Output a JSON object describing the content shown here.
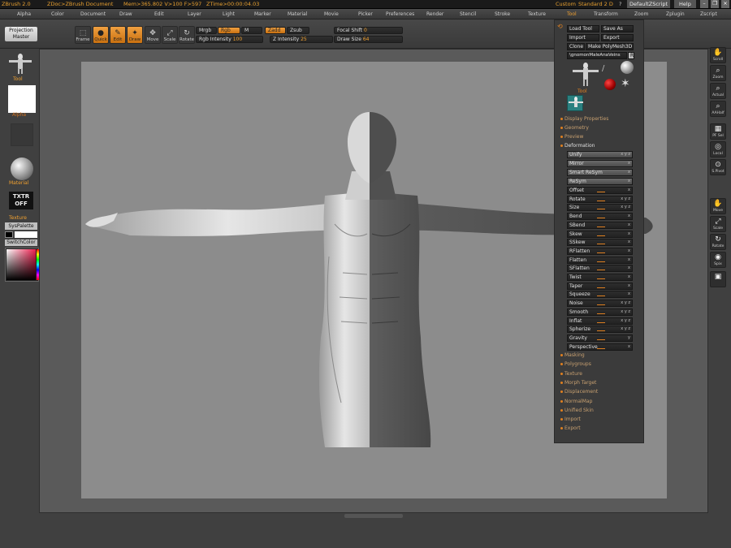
{
  "titlebar": {
    "app": "ZBrush 2.0",
    "document": "ZDoc>ZBrush Document",
    "stats": "Mem>365.802  V>100  F>597",
    "ztime": "ZTime>00:00:04.03",
    "custom": "Custom",
    "layout": "Standard 2 D",
    "question": "?",
    "script": "DefaultZScript",
    "help": "Help"
  },
  "menu": [
    "Alpha",
    "Color",
    "Document",
    "Draw",
    "Edit",
    "Layer",
    "Light",
    "Marker",
    "Material",
    "Movie",
    "Picker",
    "Preferences",
    "Render",
    "Stencil",
    "Stroke",
    "Texture",
    "Tool",
    "Transform",
    "Zoom",
    "Zplugin",
    "Zscript"
  ],
  "left": {
    "projection_master": "Projection Master",
    "tool_label": "Tool",
    "alpha_label": "Alpha",
    "material_label": "Material",
    "texture_button": "TXTR OFF",
    "texture_label": "Texture",
    "syspalette": "SysPalette",
    "switchcolor": "SwitchColor"
  },
  "toolbar": {
    "frame": "Frame",
    "quick": "Quick",
    "edit": "Edit",
    "draw": "Draw",
    "move": "Move",
    "scale": "Scale",
    "rotate": "Rotate",
    "mrgb": "Mrgb",
    "rgb": "Rgb",
    "m": "M",
    "zadd": "Zadd",
    "zsub": "Zsub",
    "rgb_intensity_label": "Rgb Intensity",
    "rgb_intensity_value": "100",
    "z_intensity_label": "Z Intensity",
    "z_intensity_value": "25",
    "focal_shift_label": "Focal Shift",
    "focal_shift_value": "0",
    "draw_size_label": "Draw Size",
    "draw_size_value": "64"
  },
  "toolpanel": {
    "load_tool": "Load Tool",
    "save_as": "Save As",
    "import": "Import",
    "export": "Export",
    "clone": "Clone",
    "make_polymesh": "Make PolyMesh3D",
    "current_tool": "\\gnomonMaleAnaVeins",
    "r_button": "R",
    "tool_label": "Tool",
    "sections_top": [
      "Display Properties",
      "Geometry",
      "Preview",
      "Deformation"
    ],
    "deform_top": [
      {
        "label": "Unify",
        "axes": "x y z"
      },
      {
        "label": "Mirror",
        "axes": "x"
      },
      {
        "label": "Smart ReSym",
        "axes": "x"
      },
      {
        "label": "ReSym",
        "axes": "x"
      }
    ],
    "deform_sliders": [
      {
        "label": "Offset",
        "axes": "x"
      },
      {
        "label": "Rotate",
        "axes": "x y z"
      },
      {
        "label": "Size",
        "axes": "x y z"
      },
      {
        "label": "Bend",
        "axes": "x"
      },
      {
        "label": "SBend",
        "axes": "x"
      },
      {
        "label": "Skew",
        "axes": "x"
      },
      {
        "label": "SSkew",
        "axes": "x"
      },
      {
        "label": "RFlatten",
        "axes": "x"
      },
      {
        "label": "Flatten",
        "axes": "x"
      },
      {
        "label": "SFlatten",
        "axes": "x"
      },
      {
        "label": "Twist",
        "axes": "x"
      },
      {
        "label": "Taper",
        "axes": "x"
      },
      {
        "label": "Squeeze",
        "axes": "x"
      },
      {
        "label": "Noise",
        "axes": "x y z"
      },
      {
        "label": "Smooth",
        "axes": "x y z"
      },
      {
        "label": "Inflat",
        "axes": "x y z"
      },
      {
        "label": "Spherize",
        "axes": "x y z"
      },
      {
        "label": "Gravity",
        "axes": "y"
      },
      {
        "label": "Perspective",
        "axes": "x"
      }
    ],
    "sections_bottom": [
      "Masking",
      "Polygroups",
      "Texture",
      "Morph Target",
      "Displacement",
      "NormalMap",
      "Unified Skin",
      "Import",
      "Export"
    ]
  },
  "rightshelf": [
    "Scroll",
    "Zoom",
    "Actual",
    "AAHalf",
    "PF Sel",
    "Local",
    "S.Pivot",
    "Move",
    "Scale",
    "Rotate",
    "Spix",
    ""
  ],
  "colors": {
    "accent": "#f0a030",
    "panel": "#3b3b3b",
    "document": "#8c8c8c"
  }
}
